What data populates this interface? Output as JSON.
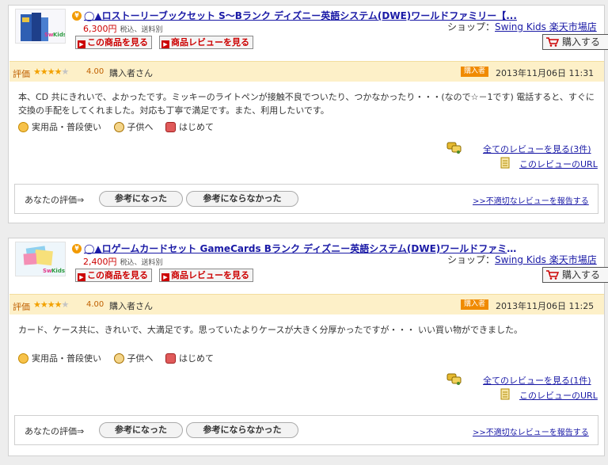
{
  "reviews": [
    {
      "product_title": "◯▲ロストーリーブックセット S～Bランク ディズニー英語システム(DWE)ワールドファミリー【...",
      "price": "6,300円",
      "price_note": "税込、送料別",
      "shop_label": "ショップ：",
      "shop_name": "Swing  Kids  楽天市場店",
      "view_product_button": "この商品を見る",
      "product_reviews_button": "商品レビューを見る",
      "cart_button": "購入する",
      "rating_label": "評価",
      "rating_stars": 4,
      "rating_score": "4.00",
      "reviewer": "購入者さん",
      "buyer_badge": "購入者",
      "date": "2013年11月06日 11:31",
      "review_text": "本、CD 共にきれいで、よかったです。ミッキーのライトペンが接触不良でついたり、つかなかったり・・・(なので☆－1です) 電話すると、すぐに交換の手配をしてくれました。対応も丁寧で満足です。また、利用したいです。",
      "tags": [
        "実用品・普段使い",
        "子供へ",
        "はじめて"
      ],
      "all_reviews_link": "全てのレビューを見る(3件)",
      "review_url_link": "このレビューのURL",
      "your_rating_label": "あなたの評価⇒",
      "helpful_button": "参考になった",
      "not_helpful_button": "参考にならなかった",
      "report_link": ">>不適切なレビューを報告する"
    },
    {
      "product_title": "◯▲ロゲームカードセット GameCards Bランク ディズニー英語システム(DWE)ワールドファミリー...",
      "price": "2,400円",
      "price_note": "税込、送料別",
      "shop_label": "ショップ：",
      "shop_name": "Swing  Kids  楽天市場店",
      "view_product_button": "この商品を見る",
      "product_reviews_button": "商品レビューを見る",
      "cart_button": "購入する",
      "rating_label": "評価",
      "rating_stars": 4,
      "rating_score": "4.00",
      "reviewer": "購入者さん",
      "buyer_badge": "購入者",
      "date": "2013年11月06日 11:25",
      "review_text": "カード、ケース共に、きれいで、大満足です。思っていたよりケースが大きく分厚かったですが・・・ いい買い物ができました。",
      "tags": [
        "実用品・普段使い",
        "子供へ",
        "はじめて"
      ],
      "all_reviews_link": "全てのレビューを見る(1件)",
      "review_url_link": "このレビューのURL",
      "your_rating_label": "あなたの評価⇒",
      "helpful_button": "参考になった",
      "not_helpful_button": "参考にならなかった",
      "report_link": ">>不適切なレビューを報告する"
    }
  ],
  "colors": {
    "link": "#1a1aa6",
    "price": "#cc0000",
    "rating_bar": "#fdf0c8",
    "badge": "#f08a00",
    "star": "#f2a100"
  },
  "tag_icons": [
    "hand-icon",
    "child-icon",
    "gift-icon"
  ]
}
